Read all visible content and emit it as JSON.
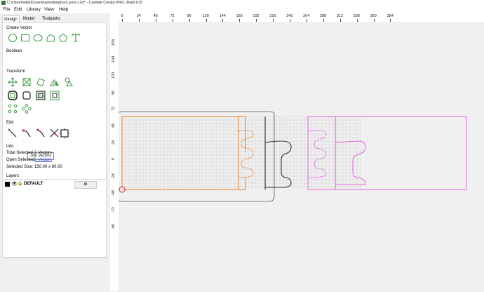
{
  "window": {
    "title": "C:\\Users\\willa\\Downloads\\dongfuzil_joint.c2d* - Carbide Create PRO, Build 815"
  },
  "menu": [
    {
      "label": "File"
    },
    {
      "label": "Edit"
    },
    {
      "label": "Library"
    },
    {
      "label": "View"
    },
    {
      "label": "Help"
    }
  ],
  "tabs": [
    "Design",
    "Model",
    "Toolpaths"
  ],
  "panel": {
    "create_vector": "Create Vector",
    "boolean": "Boolean",
    "transform": "Transform",
    "edit": "Edit",
    "tooltip": "Join Vectors",
    "info": {
      "heading": "Info",
      "total_label": "Total Selected:",
      "total_value": "2 Vectors",
      "open_label": "Open Selected:",
      "open_value": "2 Vectors",
      "size_label": "Selected Size:",
      "size_value": "150.00 x 80.00"
    },
    "layers": {
      "heading": "Layers",
      "name": "DEFAULT"
    }
  },
  "ruler": {
    "x_ticks": [
      "0",
      "24",
      "48",
      "72",
      "96",
      "120",
      "144",
      "168",
      "192",
      "216",
      "240",
      "264",
      "288",
      "312",
      "336",
      "360",
      "384"
    ],
    "y_ticks": [
      "168",
      "144",
      "120",
      "96",
      "72",
      "48",
      "24",
      "0",
      "-24",
      "-48",
      "-72",
      "-96"
    ]
  },
  "colors": {
    "accent": "#3c9a3c",
    "selection": "#e87a20",
    "magenta": "#e040e0",
    "outline": "#555555"
  }
}
